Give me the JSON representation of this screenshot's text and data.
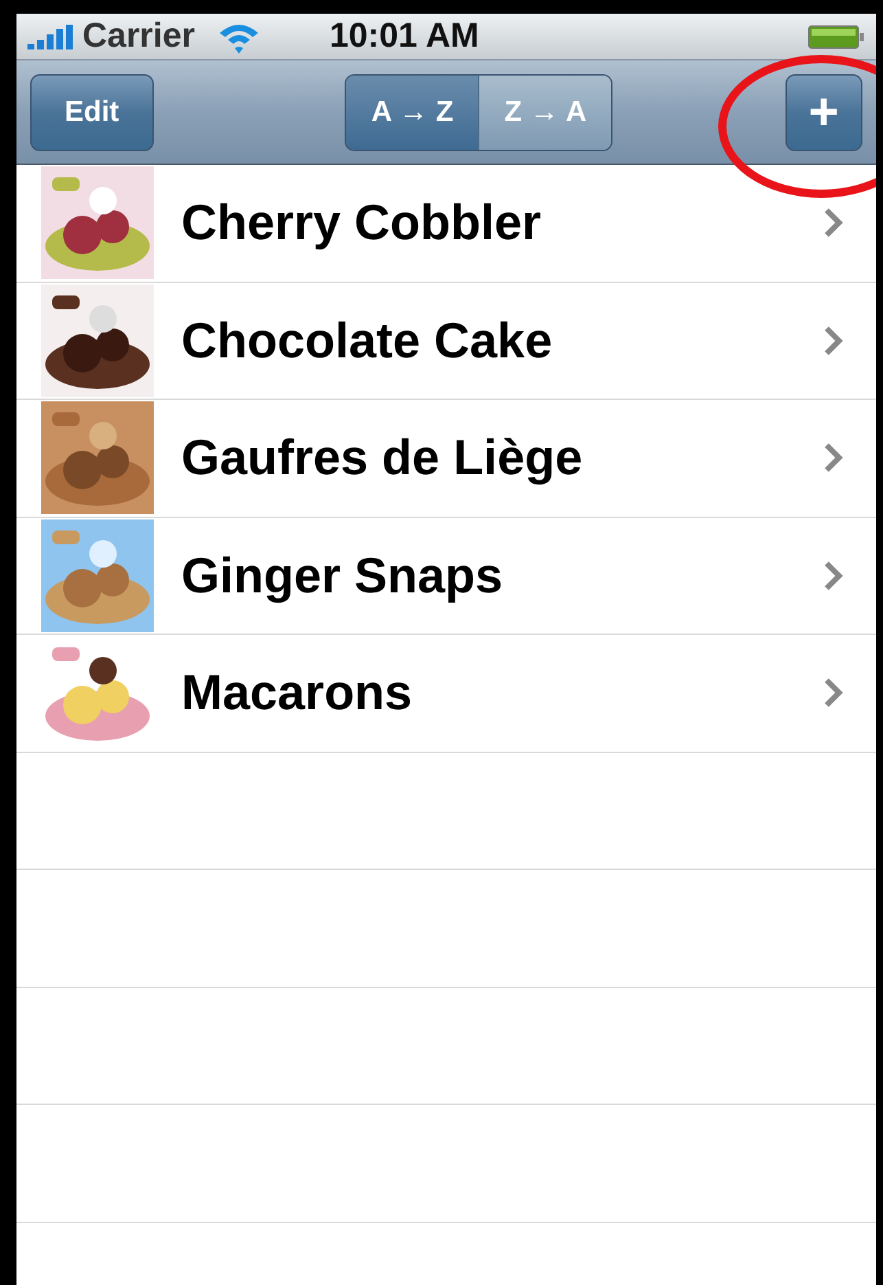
{
  "status_bar": {
    "carrier": "Carrier",
    "time": "10:01 AM"
  },
  "nav_bar": {
    "edit_button": "Edit",
    "sort_segments": [
      {
        "label": "A → Z",
        "selected": true
      },
      {
        "label": "Z → A",
        "selected": false
      }
    ],
    "add_button": "+",
    "add_button_circled": true
  },
  "recipes": [
    {
      "name": "Cherry Cobbler"
    },
    {
      "name": "Chocolate Cake"
    },
    {
      "name": "Gaufres de Liège"
    },
    {
      "name": "Ginger Snaps"
    },
    {
      "name": "Macarons"
    }
  ]
}
